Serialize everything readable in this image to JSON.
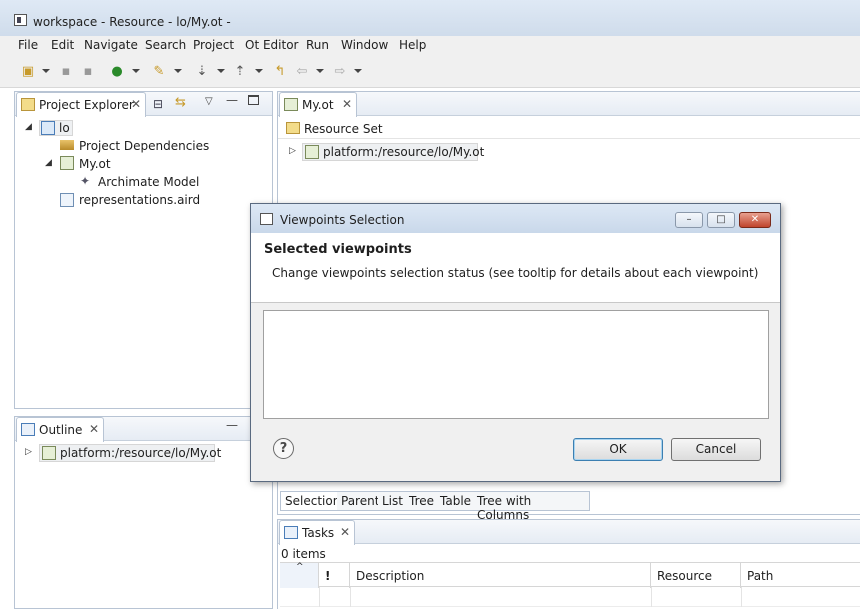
{
  "window": {
    "title": "workspace - Resource - lo/My.ot -"
  },
  "menu": [
    "File",
    "Edit",
    "Navigate",
    "Search",
    "Project",
    "Ot Editor",
    "Run",
    "Window",
    "Help"
  ],
  "project_explorer": {
    "tab_label": "Project Explorer",
    "items": [
      {
        "label": "lo",
        "icon": "project-folder-icon"
      },
      {
        "label": "Project Dependencies",
        "icon": "library-icon"
      },
      {
        "label": "My.ot",
        "icon": "model-file-icon"
      },
      {
        "label": "Archimate Model",
        "icon": "model-element-icon"
      },
      {
        "label": "representations.aird",
        "icon": "aird-file-icon"
      }
    ]
  },
  "outline": {
    "tab_label": "Outline",
    "item": "platform:/resource/lo/My.ot"
  },
  "editor": {
    "tab_label": "My.ot",
    "resource_set": "Resource Set",
    "resource_item": "platform:/resource/lo/My.ot",
    "bottom_tabs": [
      "Selection",
      "Parent",
      "List",
      "Tree",
      "Table",
      "Tree with Columns"
    ]
  },
  "tasks": {
    "tab_label": "Tasks",
    "count": "0 items",
    "columns": [
      "!",
      "Description",
      "Resource",
      "Path"
    ]
  },
  "dialog": {
    "title": "Viewpoints Selection",
    "heading": "Selected viewpoints",
    "message": "Change viewpoints selection status (see tooltip for details about each viewpoint)",
    "ok_label": "OK",
    "cancel_label": "Cancel",
    "help_glyph": "?"
  }
}
